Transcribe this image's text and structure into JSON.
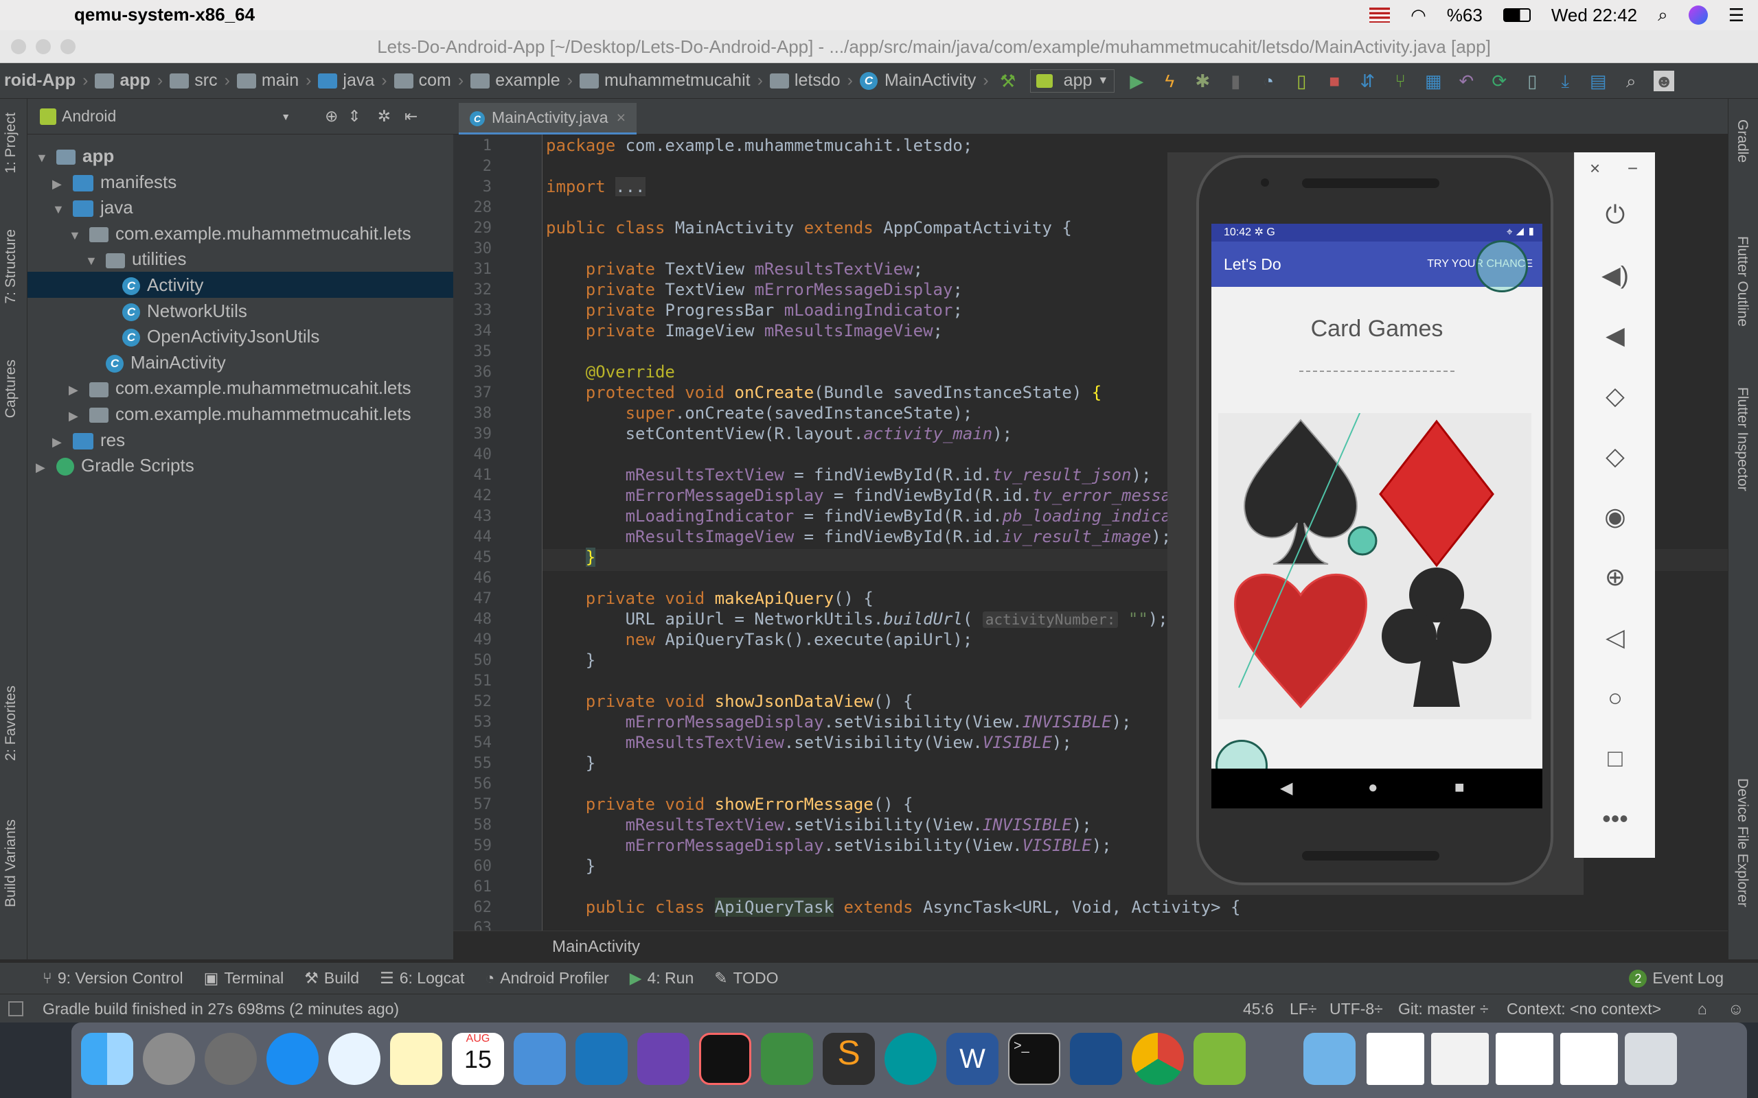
{
  "menubar": {
    "app_name": "qemu-system-x86_64",
    "battery": "%63",
    "clock": "Wed 22:42"
  },
  "window": {
    "title": "Lets-Do-Android-App [~/Desktop/Lets-Do-Android-App] - .../app/src/main/java/com/example/muhammetmucahit/letsdo/MainActivity.java [app]"
  },
  "navbar": {
    "crumbs": [
      "roid-App",
      "app",
      "src",
      "main",
      "java",
      "com",
      "example",
      "muhammetmucahit",
      "letsdo",
      "MainActivity"
    ],
    "run_config": "app"
  },
  "left_strip": {
    "tabs": [
      "1: Project",
      "7: Structure",
      "Captures",
      "2: Favorites",
      "Build Variants"
    ]
  },
  "right_strip": {
    "tabs": [
      "Gradle",
      "Flutter Outline",
      "Flutter Inspector",
      "Device File Explorer"
    ]
  },
  "project": {
    "view": "Android",
    "tree": [
      {
        "label": "app",
        "depth": 0,
        "kind": "module",
        "arrow": "▼"
      },
      {
        "label": "manifests",
        "depth": 1,
        "kind": "folder",
        "arrow": "▶"
      },
      {
        "label": "java",
        "depth": 1,
        "kind": "folder",
        "arrow": "▼"
      },
      {
        "label": "com.example.muhammetmucahit.lets",
        "depth": 2,
        "kind": "package",
        "arrow": "▼"
      },
      {
        "label": "utilities",
        "depth": 3,
        "kind": "package",
        "arrow": "▼"
      },
      {
        "label": "Activity",
        "depth": 4,
        "kind": "class",
        "arrow": "",
        "selected": true
      },
      {
        "label": "NetworkUtils",
        "depth": 4,
        "kind": "class",
        "arrow": ""
      },
      {
        "label": "OpenActivityJsonUtils",
        "depth": 4,
        "kind": "class",
        "arrow": ""
      },
      {
        "label": "MainActivity",
        "depth": 3,
        "kind": "class",
        "arrow": ""
      },
      {
        "label": "com.example.muhammetmucahit.lets",
        "depth": 2,
        "kind": "package",
        "arrow": "▶"
      },
      {
        "label": "com.example.muhammetmucahit.lets",
        "depth": 2,
        "kind": "package",
        "arrow": "▶"
      },
      {
        "label": "res",
        "depth": 1,
        "kind": "folder",
        "arrow": "▶"
      },
      {
        "label": "Gradle Scripts",
        "depth": 0,
        "kind": "gradle",
        "arrow": "▶"
      }
    ]
  },
  "editor": {
    "tab": "MainActivity.java",
    "line_numbers": [
      "1",
      "2",
      "3",
      "28",
      "29",
      "30",
      "31",
      "32",
      "33",
      "34",
      "35",
      "36",
      "37",
      "38",
      "39",
      "40",
      "41",
      "42",
      "43",
      "44",
      "45",
      "46",
      "47",
      "48",
      "49",
      "50",
      "51",
      "52",
      "53",
      "54",
      "55",
      "56",
      "57",
      "58",
      "59",
      "60",
      "61",
      "62",
      "63"
    ],
    "breadcrumb": "MainActivity"
  },
  "toolwindows": {
    "version_control": "9: Version Control",
    "terminal": "Terminal",
    "build": "Build",
    "logcat": "6: Logcat",
    "profiler": "Android Profiler",
    "run": "4: Run",
    "todo": "TODO",
    "event_log": "Event Log",
    "event_count": "2"
  },
  "status": {
    "message": "Gradle build finished in 27s 698ms (2 minutes ago)",
    "position": "45:6",
    "line_sep": "LF÷",
    "encoding": "UTF-8÷",
    "git": "Git: master ÷",
    "context": "Context: <no context>"
  },
  "emulator": {
    "time": "10:42",
    "app_title": "Let's Do",
    "action": "TRY YOUR CHANCE",
    "heading": "Card Games",
    "accent": "#3f51b5",
    "status_bg": "#303f9f"
  },
  "dock": {
    "calendar_month": "AUG",
    "calendar_day": "15"
  }
}
